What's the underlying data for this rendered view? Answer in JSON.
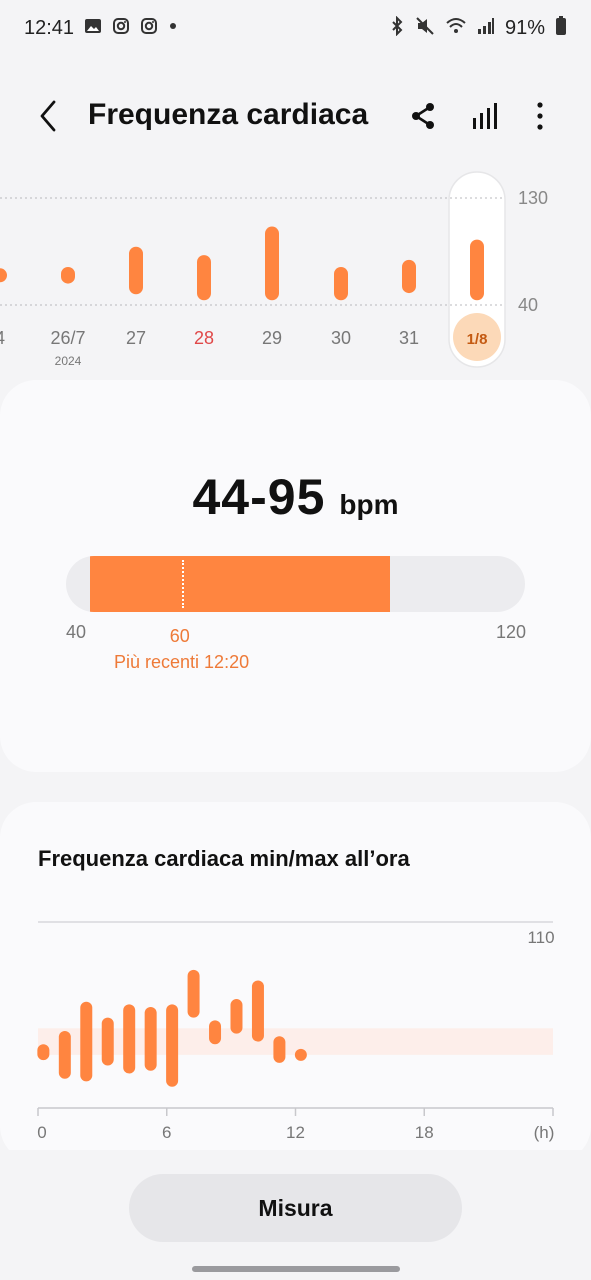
{
  "status_bar": {
    "time": "12:41",
    "battery": "91%",
    "left_icons": [
      "gallery-icon",
      "instagram-icon",
      "instagram-icon",
      "dot-icon"
    ],
    "right_icons": [
      "bluetooth-icon",
      "mute-icon",
      "wifi-icon",
      "signal-icon",
      "battery-icon"
    ]
  },
  "app_bar": {
    "title": "Frequenza cardiaca",
    "back_icon": "back-arrow-icon",
    "actions": [
      "share-icon",
      "chart-icon",
      "more-icon"
    ]
  },
  "week_chart": {
    "y_top_label": "130",
    "y_bottom_label": "40",
    "days": [
      {
        "label": "4",
        "sublabel": "",
        "min": 65,
        "max": 65,
        "color": "#777777"
      },
      {
        "label": "26/7",
        "sublabel": "2024",
        "min": 58,
        "max": 72,
        "color": "#777777"
      },
      {
        "label": "27",
        "sublabel": "",
        "min": 49,
        "max": 89,
        "color": "#777777"
      },
      {
        "label": "28",
        "sublabel": "",
        "min": 44,
        "max": 82,
        "color": "#e04848"
      },
      {
        "label": "29",
        "sublabel": "",
        "min": 44,
        "max": 106,
        "color": "#777777"
      },
      {
        "label": "30",
        "sublabel": "",
        "min": 44,
        "max": 72,
        "color": "#777777"
      },
      {
        "label": "31",
        "sublabel": "",
        "min": 50,
        "max": 78,
        "color": "#777777"
      },
      {
        "label": "1/8",
        "sublabel": "",
        "min": 44,
        "max": 95,
        "selected": true,
        "color": "#c45a12"
      }
    ]
  },
  "summary": {
    "range_text": "44-95",
    "unit": "bpm",
    "range_min_label": "40",
    "range_max_label": "120",
    "recent_value": "60",
    "recent_label": "Più recenti 12:20",
    "value_min": 44,
    "value_max": 95,
    "scale_min": 40,
    "scale_max": 120,
    "recent": 60
  },
  "hourly": {
    "title": "Frequenza cardiaca min/max all’ora",
    "y_label": "110",
    "x_ticks": [
      "0",
      "6",
      "12",
      "18",
      "(h)"
    ],
    "scale_min": 40,
    "scale_max": 110,
    "normal_band": [
      60,
      70
    ],
    "bars": [
      {
        "hour": 0,
        "min": 58,
        "max": 64
      },
      {
        "hour": 1,
        "min": 51,
        "max": 69
      },
      {
        "hour": 2,
        "min": 50,
        "max": 80
      },
      {
        "hour": 3,
        "min": 56,
        "max": 74
      },
      {
        "hour": 4,
        "min": 53,
        "max": 79
      },
      {
        "hour": 5,
        "min": 54,
        "max": 78
      },
      {
        "hour": 6,
        "min": 48,
        "max": 79
      },
      {
        "hour": 7,
        "min": 74,
        "max": 92
      },
      {
        "hour": 8,
        "min": 64,
        "max": 73
      },
      {
        "hour": 9,
        "min": 68,
        "max": 81
      },
      {
        "hour": 10,
        "min": 65,
        "max": 88
      },
      {
        "hour": 11,
        "min": 57,
        "max": 67
      },
      {
        "hour": 12,
        "min": 60,
        "max": 60
      }
    ]
  },
  "measure_button": {
    "label": "Misura"
  },
  "colors": {
    "accent": "#ff8540",
    "accent_text": "#ee7a38",
    "band": "#fdeeea",
    "selected_bg": "#fcd9b8"
  }
}
